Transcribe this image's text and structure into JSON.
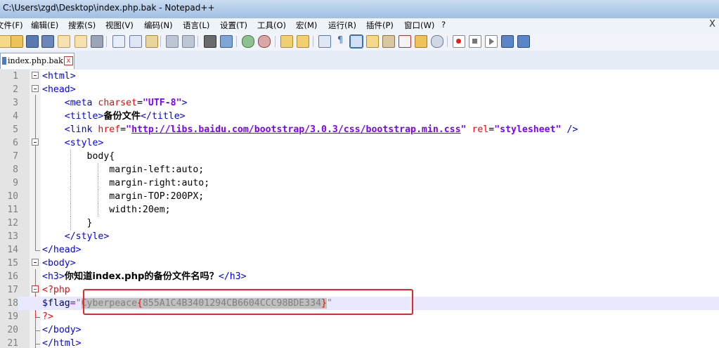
{
  "window": {
    "title": "C:\\Users\\zgd\\Desktop\\index.php.bak - Notepad++"
  },
  "menu": {
    "items": [
      "文件(F)",
      "编辑(E)",
      "搜索(S)",
      "视图(V)",
      "编码(N)",
      "语言(L)",
      "设置(T)",
      "工具(O)",
      "宏(M)",
      "运行(R)",
      "插件(P)",
      "窗口(W)",
      "?"
    ],
    "close": "X"
  },
  "toolbar": {
    "icons": [
      "new-file-icon",
      "open-file-icon",
      "save-icon",
      "save-all-icon",
      "close-icon",
      "close-all-icon",
      "print-icon",
      "cut-icon",
      "copy-icon",
      "paste-icon",
      "undo-icon",
      "redo-icon",
      "find-icon",
      "replace-icon",
      "zoom-in-icon",
      "zoom-out-icon",
      "sync-v-icon",
      "sync-h-icon",
      "word-wrap-icon",
      "show-all-chars-icon",
      "indent-guide-icon",
      "udl-icon",
      "doc-map-icon",
      "function-list-icon",
      "folder-workspace-icon",
      "monitor-icon",
      "record-macro-icon",
      "stop-macro-icon",
      "play-macro-icon",
      "run-macro-multiple-icon",
      "save-macro-icon"
    ]
  },
  "tabs": [
    {
      "label": "index.php.bak",
      "close": "x"
    }
  ],
  "editor": {
    "line_numbers": [
      "1",
      "2",
      "3",
      "4",
      "5",
      "6",
      "7",
      "8",
      "9",
      "10",
      "11",
      "12",
      "13",
      "14",
      "15",
      "16",
      "17",
      "18",
      "19",
      "20",
      "21"
    ],
    "code": {
      "l1": "<html>",
      "l2": "<head>",
      "l3_indent": "    ",
      "l3_open": "<meta ",
      "l3_attr": "charset",
      "l3_eq": "=",
      "l3_val": "\"UTF-8\"",
      "l3_close": ">",
      "l4_indent": "    ",
      "l4_open": "<title>",
      "l4_text": "备份文件",
      "l4_close": "</title>",
      "l5_indent": "    ",
      "l5_open": "<link ",
      "l5_attr1": "href",
      "l5_eq1": "=",
      "l5_q1": "\"",
      "l5_url": "http://libs.baidu.com/bootstrap/3.0.3/css/bootstrap.min.css",
      "l5_q2": "\"",
      "l5_sp": " ",
      "l5_attr2": "rel",
      "l5_eq2": "=",
      "l5_val2": "\"stylesheet\"",
      "l5_close": " />",
      "l6_indent": "    ",
      "l6": "<style>",
      "l7": "        body{",
      "l8": "            margin-left:auto;",
      "l9": "            margin-right:auto;",
      "l10": "            margin-TOP:200PX;",
      "l11": "            width:20em;",
      "l12": "        }",
      "l13_indent": "    ",
      "l13": "</style>",
      "l14": "</head>",
      "l15": "<body>",
      "l16_open": "<h3>",
      "l16_text": "你知道index.php的备份文件名吗？",
      "l16_close": "</h3>",
      "l17": "<?php",
      "l18_var": "$flag",
      "l18_eq": "=",
      "l18_q1": "\"",
      "l18_prefix": "Cyberpeace",
      "l18_lbrace": "{",
      "l18_hash": "855A1C4B3401294CB6604CCC98BDE334",
      "l18_rbrace": "}",
      "l18_q2": "\"",
      "l19": "?>",
      "l20": "</body>",
      "l21": "</html>"
    }
  },
  "colors": {
    "tag": "#0000ff",
    "attribute": "#ff0000",
    "string": "#8000ff",
    "current_line": "#e8e8ff",
    "highlight_box": "#e8272b"
  }
}
